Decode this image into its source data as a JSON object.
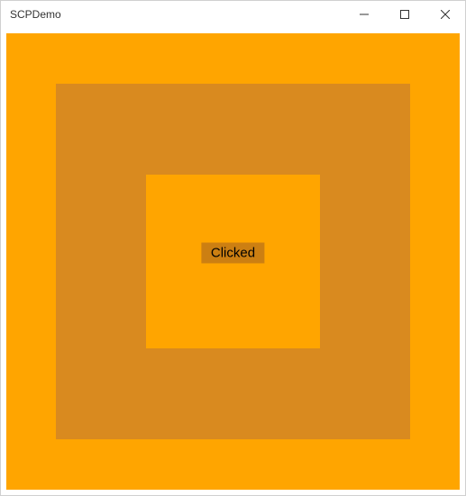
{
  "window": {
    "title": "SCPDemo"
  },
  "content": {
    "button_label": "Clicked"
  },
  "colors": {
    "outer": "#ffa500",
    "middle": "#d98a1f",
    "inner": "#ffa500",
    "button": "#cc7f12"
  }
}
